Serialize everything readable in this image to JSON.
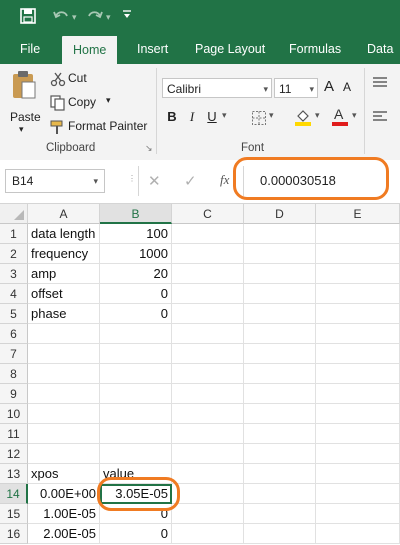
{
  "quick_access": {
    "save_icon": "save-icon",
    "undo_icon": "undo-icon",
    "redo_icon": "redo-icon",
    "customize_icon": "customize-toolbar-icon"
  },
  "ribbon_tabs": [
    "File",
    "Home",
    "Insert",
    "Page Layout",
    "Formulas",
    "Data"
  ],
  "active_tab": "Home",
  "clipboard": {
    "paste": "Paste",
    "cut": "Cut",
    "copy": "Copy",
    "format_painter": "Format Painter",
    "group_label": "Clipboard"
  },
  "font": {
    "name": "Calibri",
    "size": "11",
    "bold": "B",
    "italic": "I",
    "underline": "U",
    "font_color_letter": "A",
    "grow_letter": "A",
    "shrink_letter": "A",
    "group_label": "Font"
  },
  "formula_bar": {
    "name_box": "B14",
    "fx": "fx",
    "value": "0.000030518"
  },
  "columns": [
    "A",
    "B",
    "C",
    "D",
    "E"
  ],
  "selected_column": "B",
  "selected_row": "14",
  "rows": [
    {
      "n": "1",
      "a": "data length",
      "b": "100"
    },
    {
      "n": "2",
      "a": "frequency",
      "b": "1000"
    },
    {
      "n": "3",
      "a": "amp",
      "b": "20"
    },
    {
      "n": "4",
      "a": "offset",
      "b": "0"
    },
    {
      "n": "5",
      "a": "phase",
      "b": "0"
    },
    {
      "n": "6",
      "a": "",
      "b": ""
    },
    {
      "n": "7",
      "a": "",
      "b": ""
    },
    {
      "n": "8",
      "a": "",
      "b": ""
    },
    {
      "n": "9",
      "a": "",
      "b": ""
    },
    {
      "n": "10",
      "a": "",
      "b": ""
    },
    {
      "n": "11",
      "a": "",
      "b": ""
    },
    {
      "n": "12",
      "a": "",
      "b": ""
    },
    {
      "n": "13",
      "a": "xpos",
      "b": "value"
    },
    {
      "n": "14",
      "a": "0.00E+00",
      "b": "3.05E-05"
    },
    {
      "n": "15",
      "a": "1.00E-05",
      "b": "0"
    },
    {
      "n": "16",
      "a": "2.00E-05",
      "b": "0"
    }
  ],
  "colors": {
    "brand": "#217346",
    "highlight": "#f07b22",
    "highlight_fill": "#ffd800",
    "font_color": "#e01b1b"
  }
}
